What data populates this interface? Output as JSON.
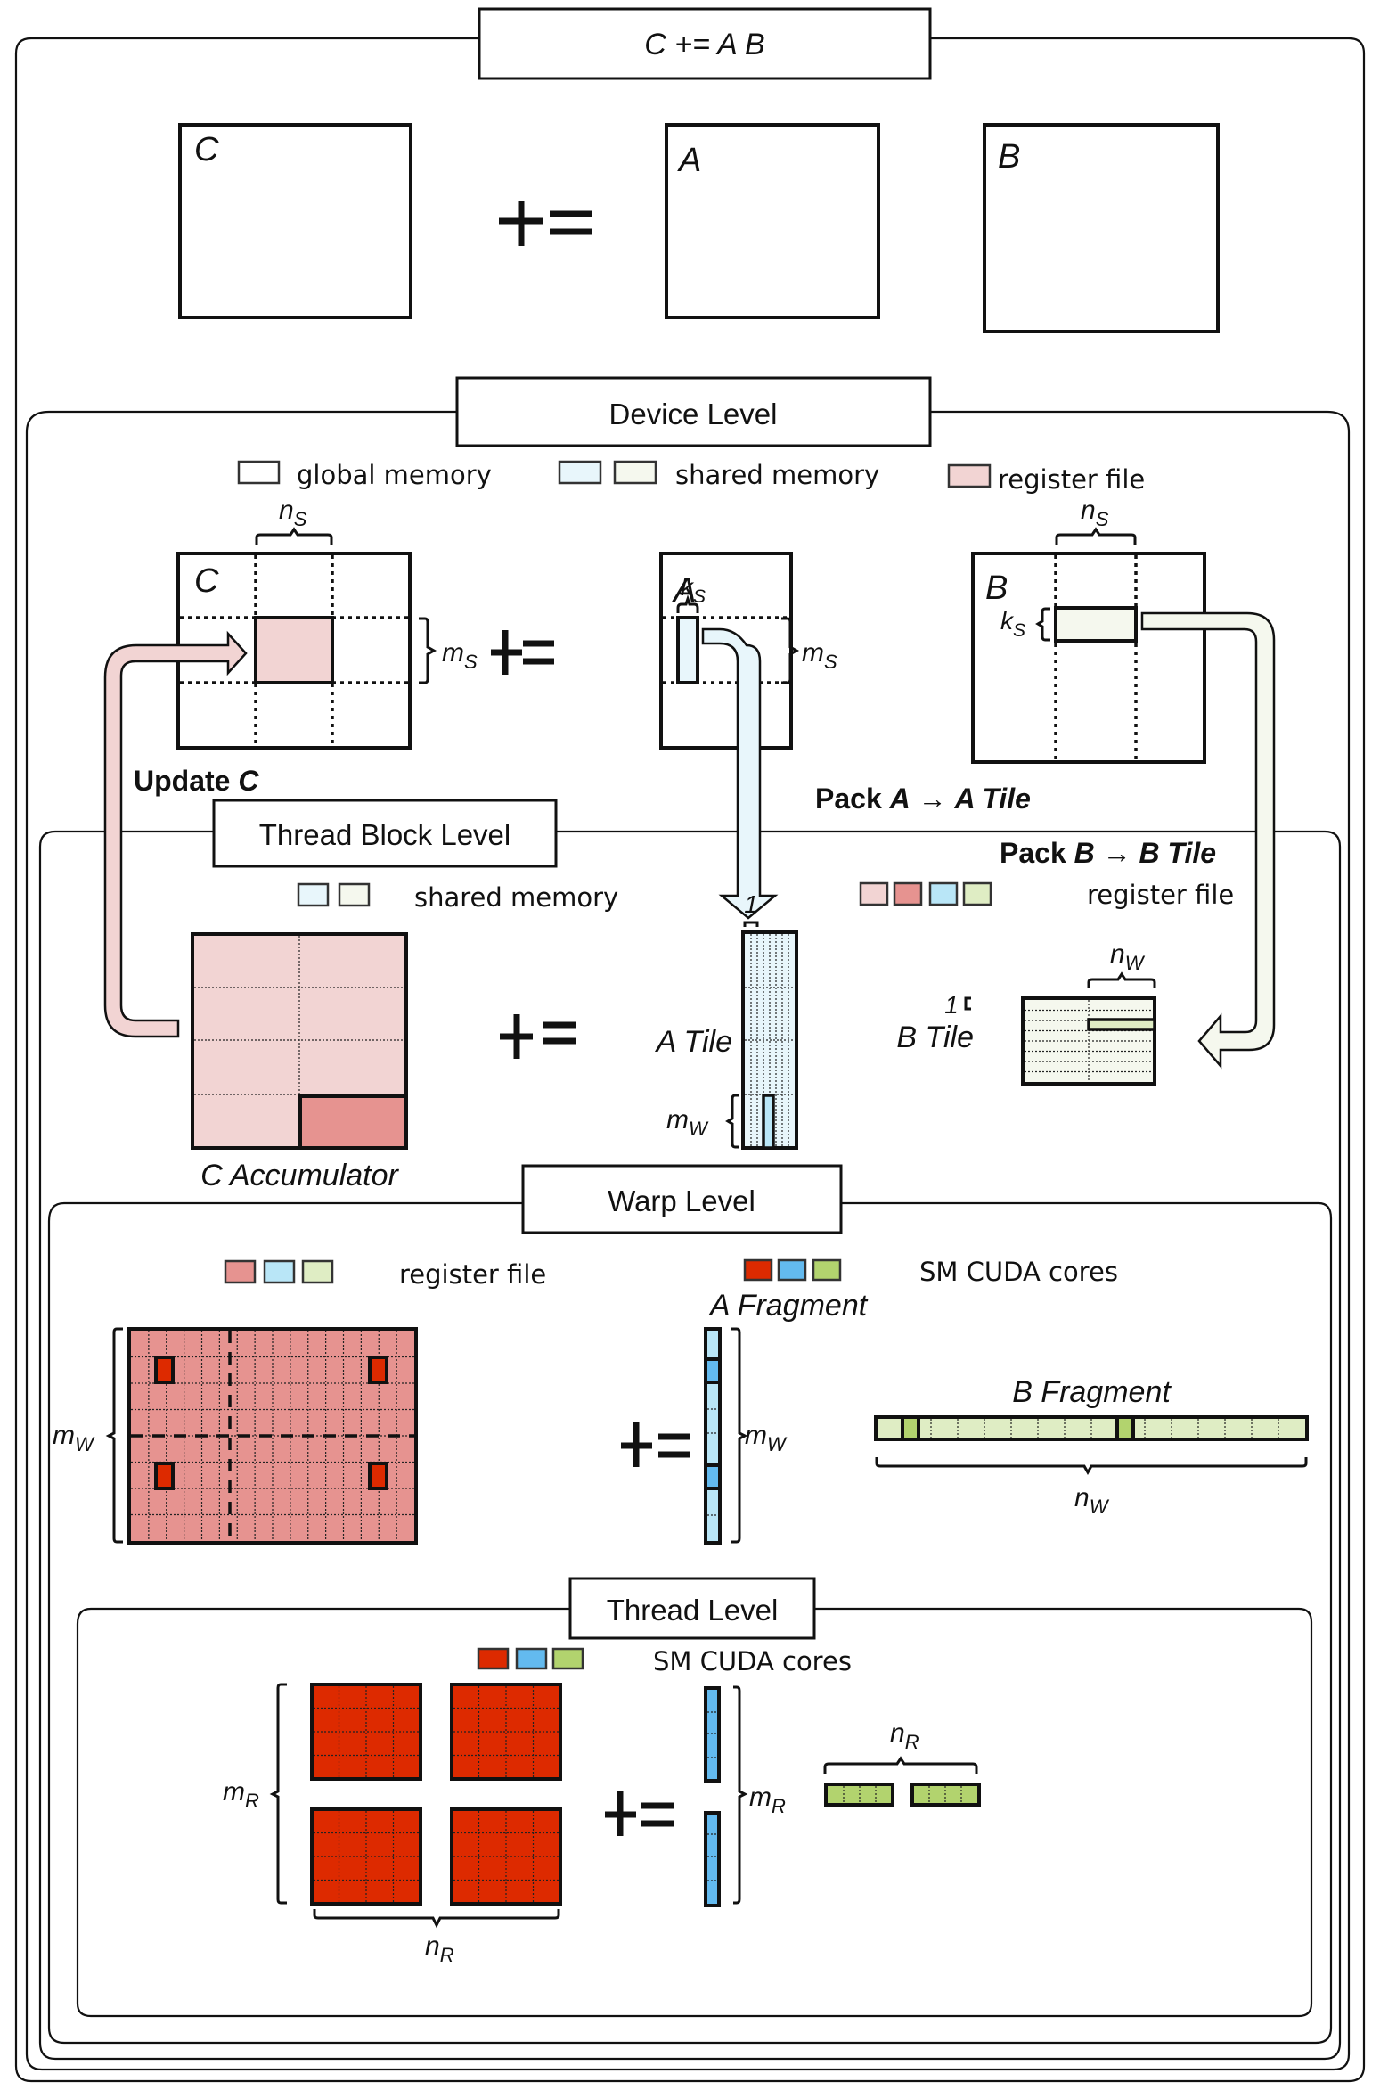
{
  "colors": {
    "global_memory": "#ffffff",
    "shared_a": "#e8f6fb",
    "shared_b": "#f5f8ee",
    "register_c_light": "#f2d4d3",
    "register_c": "#e69390",
    "register_a": "#b9e6f7",
    "register_b": "#dfedc4",
    "core_c": "#dd2a00",
    "core_a": "#63baef",
    "core_b": "#b2d36e"
  },
  "top": {
    "title": "C += A B",
    "matrix_c": "C",
    "matrix_a": "A",
    "matrix_b": "B",
    "operator": "+="
  },
  "device": {
    "title": "Device Level",
    "legend": {
      "global": "global memory",
      "shared": "shared memory",
      "register": "register file"
    },
    "matrix_c": "C",
    "matrix_a": "A",
    "matrix_b": "B",
    "c_ns": "n",
    "c_ns_sub": "S",
    "c_ms": "m",
    "c_ms_sub": "S",
    "a_ks": "k",
    "a_ks_sub": "S",
    "a_ms": "m",
    "a_ms_sub": "S",
    "b_ns": "n",
    "b_ns_sub": "S",
    "b_ks": "k",
    "b_ks_sub": "S",
    "operator": "+=",
    "update_c_prefix": "Update ",
    "update_c_var": "C",
    "pack_a": {
      "prefix": "Pack ",
      "a": "A",
      "arrow": " → ",
      "tile": "A Tile"
    },
    "pack_b": {
      "prefix": "Pack ",
      "b": "B",
      "arrow": " → ",
      "tile": "B Tile"
    }
  },
  "threadblock": {
    "title": "Thread Block Level",
    "legend_shared": "shared memory",
    "legend_register": "register file",
    "c_accumulator": "C Accumulator",
    "a_tile": "A Tile",
    "b_tile": "B Tile",
    "a_one": "1",
    "b_one": "1",
    "mw": "m",
    "mw_sub": "W",
    "nw": "n",
    "nw_sub": "W",
    "operator": "+="
  },
  "warp": {
    "title": "Warp Level",
    "legend_register": "register file",
    "legend_cores": "SM CUDA cores",
    "a_fragment": "A Fragment",
    "b_fragment": "B Fragment",
    "mw_left": "m",
    "mw_right": "m",
    "mw_sub": "W",
    "nw": "n",
    "nw_sub": "W",
    "operator": "+=",
    "grid": {
      "cols": 16,
      "rows": 8
    },
    "b_fragment_cells": 16
  },
  "thread": {
    "title": "Thread Level",
    "legend_cores": "SM CUDA cores",
    "mr_left": "m",
    "mr_right": "m",
    "mr_sub": "R",
    "nr_top": "n",
    "nr_bottom": "n",
    "nr_sub": "R",
    "operator": "+=",
    "block_grid": {
      "cols": 4,
      "rows": 4
    }
  }
}
